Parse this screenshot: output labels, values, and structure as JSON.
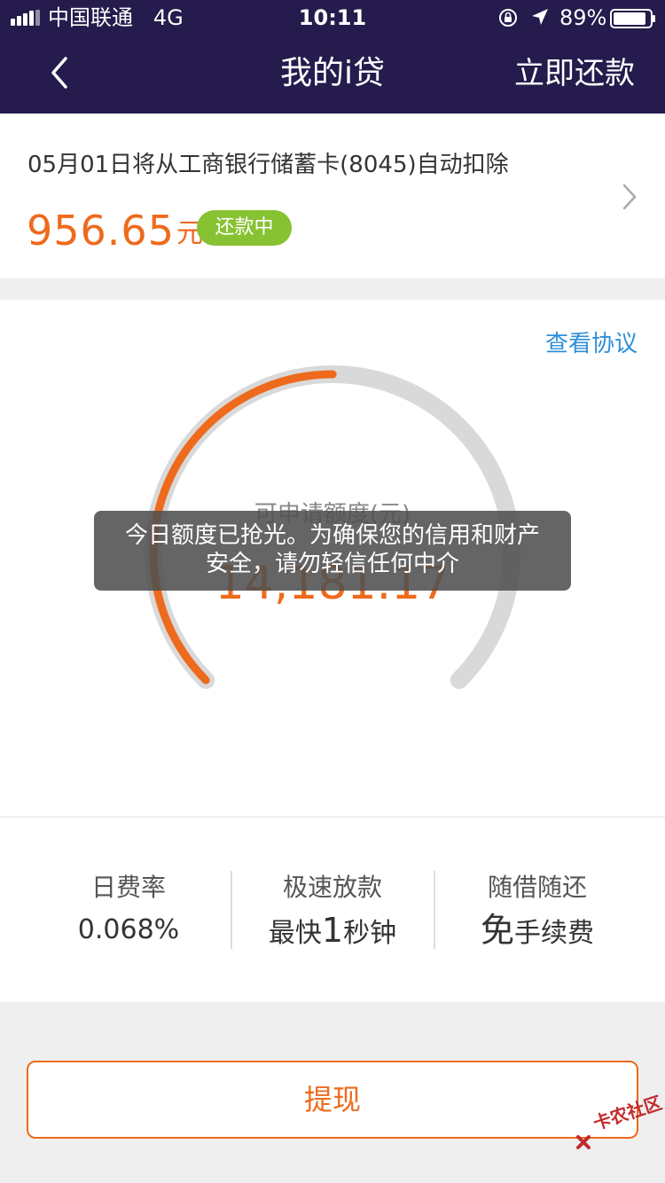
{
  "status_bar": {
    "carrier": "中国联通",
    "network": "4G",
    "time": "10:11",
    "battery": "89%"
  },
  "nav": {
    "title": "我的i贷",
    "action": "立即还款"
  },
  "repayment": {
    "notice": "05月01日将从工商银行储蓄卡(8045)自动扣除",
    "amount": "956.65",
    "unit": "元",
    "status": "还款中"
  },
  "quota": {
    "view_agreement": "查看协议",
    "label": "可申请额度(元)",
    "amount": "14,181.17",
    "gauge_fill_fraction": 0.5
  },
  "toast": {
    "line1": "今日额度已抢光。为确保您的信用和财产",
    "line2": "安全，请勿轻信任何中介"
  },
  "features": [
    {
      "title": "日费率",
      "value": "0.068%"
    },
    {
      "title": "极速放款",
      "value_prefix": "最快",
      "value_emphasis": "1",
      "value_suffix": "秒钟"
    },
    {
      "title": "随借随还",
      "value_emphasis": "免",
      "value_suffix": "手续费"
    }
  ],
  "withdraw": {
    "label": "提现"
  },
  "watermark": {
    "text": "卡农社区"
  },
  "colors": {
    "nav_bg": "#251b4c",
    "accent_orange": "#ee6a1c",
    "status_green": "#86c232",
    "link_blue": "#2e8fd8"
  }
}
